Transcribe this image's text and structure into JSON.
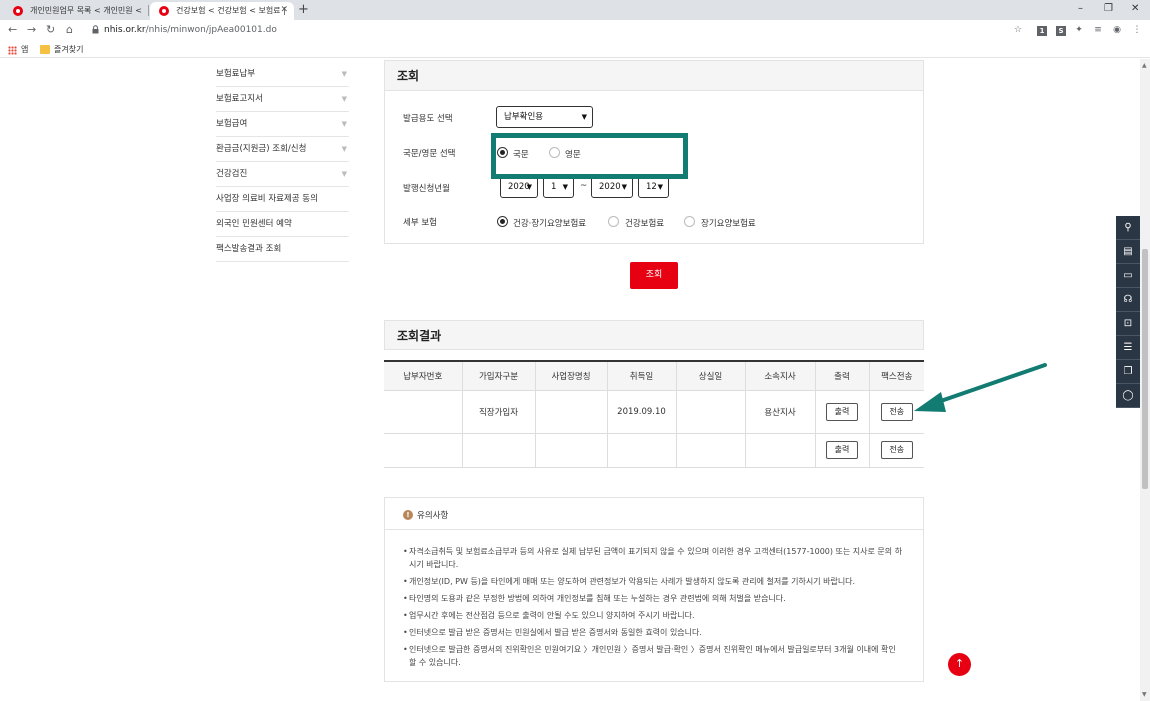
{
  "browser": {
    "tabs": [
      {
        "title": "개인민원업무 목록 < 개인민원 < ",
        "active": false
      },
      {
        "title": "건강보험 < 건강보험 < 보험료 | ",
        "active": true
      }
    ],
    "new_tab": "+",
    "url_domain": "nhis.or.kr",
    "url_path": "/nhis/minwon/jpAea00101.do",
    "window_controls": {
      "minimize": "–",
      "restore": "❐",
      "close": "✕"
    },
    "bookmarks": {
      "apps_label": "앱",
      "folder_label": "즐겨찾기"
    },
    "extensions": [
      "1",
      "S"
    ]
  },
  "sidebar": {
    "items": [
      {
        "label": "보험료납부",
        "has_arrow": true
      },
      {
        "label": "보험료고지서",
        "has_arrow": true
      },
      {
        "label": "보험급여",
        "has_arrow": true
      },
      {
        "label": "환급금(지원금) 조회/신청",
        "has_arrow": true
      },
      {
        "label": "건강검진",
        "has_arrow": true
      },
      {
        "label": "사업장 의료비 자료제공 동의",
        "has_arrow": false
      },
      {
        "label": "외국인 민원센터 예약",
        "has_arrow": false
      },
      {
        "label": "팩스발송결과 조회",
        "has_arrow": false
      }
    ],
    "arrow_glyph": "▼"
  },
  "search": {
    "title": "조회",
    "purpose_label": "발급용도 선택",
    "purpose_value": "납부확인용",
    "language_label": "국문/영문 선택",
    "language_options": [
      "국문",
      "영문"
    ],
    "period_label": "발행신청년월",
    "from_year": "2020",
    "from_month": "1",
    "separator": "~",
    "to_year": "2020",
    "to_month": "12",
    "insurance_label": "세부 보험",
    "insurance_options": [
      "건강·장기요양보험료",
      "건강보험료",
      "장기요양보험료"
    ],
    "button": "조회"
  },
  "results": {
    "title": "조회결과",
    "columns": [
      "납부자번호",
      "가입자구분",
      "사업장명칭",
      "취득일",
      "상실일",
      "소속지사",
      "출력",
      "팩스전송"
    ],
    "rows": [
      {
        "payer_no": "",
        "type": "직장가입자",
        "workplace": "",
        "acquired": "2019.09.10",
        "lost": "",
        "branch": "용산지사",
        "print": "출력",
        "fax": "전송"
      },
      {
        "payer_no": "",
        "type": "",
        "workplace": "",
        "acquired": "",
        "lost": "",
        "branch": "",
        "print": "출력",
        "fax": "전송"
      }
    ]
  },
  "notice": {
    "icon": "!",
    "title": "유의사항",
    "items": [
      "자격소급취득 및 보험료소급부과 등의 사유로 실제 납부된 금액이 표기되지 않을 수 있으며 이러한 경우 고객센터(1577-1000) 또는 지사로 문의 하시기 바랍니다.",
      "개인정보(ID, PW 등)을 타인에게 매매 또는 양도하여 관련정보가 악용되는 사례가 발생하지 않도록 관리에 철저를 기하시기 바랍니다.",
      "타인명의 도용과 같은 부정한 방법에 의하여 개인정보를 침해 또는 누설하는 경우 관련법에 의해 처벌을 받습니다.",
      "업무시간 후에는 전산점검 등으로 출력이 안될 수도 있으니 양지하여 주시기 바랍니다.",
      "인터넷으로 발급 받은 증명서는 민원실에서 발급 받은 증명서와 동일한 효력이 있습니다.",
      "인터넷으로 발급한 증명서의 진위확인은 민원여기요 〉개인민원 〉증명서 발급·확인 〉증명서 진위확인 메뉴에서 발급일로부터 3개월 이내에 확인 할 수 있습니다."
    ]
  },
  "quick_menu": [
    "person-icon",
    "document-icon",
    "monitor-icon",
    "headset-icon",
    "lock-icon",
    "list-icon",
    "copy-icon",
    "chat-icon"
  ],
  "top_button": "↑",
  "colors": {
    "accent": "#e60012",
    "highlight": "#127b72",
    "quick_bg": "#2b3645"
  }
}
